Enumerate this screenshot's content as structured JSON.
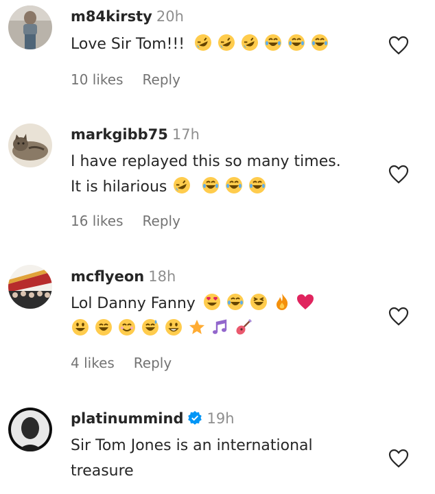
{
  "comments": [
    {
      "username": "m84kirsty",
      "time": "20h",
      "text_lines": [
        "Love Sir Tom!!!"
      ],
      "emojis_line1": [
        "rofl-emoji",
        "rofl-emoji",
        "rofl-emoji",
        "joy-emoji",
        "joy-emoji",
        "joy-emoji"
      ],
      "likes": "10 likes",
      "reply": "Reply"
    },
    {
      "username": "markgibb75",
      "time": "17h",
      "text_lines": [
        "I have replayed this so many times.",
        "It is hilarious"
      ],
      "emojis_line2": [
        "rofl-emoji",
        "joy-emoji",
        "joy-emoji",
        "joy-emoji"
      ],
      "likes": "16 likes",
      "reply": "Reply"
    },
    {
      "username": "mcflyeon",
      "time": "18h",
      "text_lines": [
        "Lol Danny Fanny"
      ],
      "emojis_line1": [
        "heart-eyes-emoji",
        "joy-emoji",
        "laughing-emoji",
        "fire-emoji",
        "red-heart-emoji"
      ],
      "emojis_line2": [
        "grinning-emoji",
        "grin-emoji",
        "smile-emoji",
        "sweat-smile-emoji",
        "slight-smile-emoji",
        "star-emoji",
        "music-notes-emoji",
        "guitar-emoji"
      ],
      "likes": "4 likes",
      "reply": "Reply"
    },
    {
      "username": "platinummind",
      "time": "19h",
      "verified": true,
      "text_lines": [
        "Sir Tom Jones is an international",
        "treasure"
      ]
    }
  ],
  "colors": {
    "text": "#262626",
    "muted": "#8e8e8e",
    "verified": "#0095f6",
    "emoji_yellow": "#ffcc4d"
  }
}
